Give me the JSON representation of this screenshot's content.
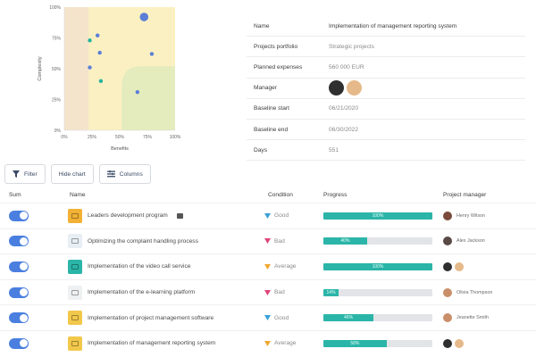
{
  "chart_data": {
    "type": "scatter",
    "xlabel": "Benefits",
    "ylabel": "Complexity",
    "xlim": [
      0,
      100
    ],
    "ylim": [
      0,
      100
    ],
    "x_ticks": [
      "0%",
      "25%",
      "50%",
      "75%",
      "100%"
    ],
    "y_ticks": [
      "0%",
      "25%",
      "50%",
      "75%",
      "100%"
    ],
    "grid": false,
    "points": [
      {
        "x": 72,
        "y": 92,
        "size": "large",
        "color": "#5b7fd6"
      },
      {
        "x": 30,
        "y": 77,
        "size": "small",
        "color": "#5b7fd6"
      },
      {
        "x": 23,
        "y": 73,
        "size": "small",
        "color": "#26b3a0"
      },
      {
        "x": 32,
        "y": 63,
        "size": "small",
        "color": "#5b7fd6"
      },
      {
        "x": 79,
        "y": 62,
        "size": "small",
        "color": "#5b7fd6"
      },
      {
        "x": 23,
        "y": 51,
        "size": "small",
        "color": "#5b7fd6"
      },
      {
        "x": 33,
        "y": 40,
        "size": "small",
        "color": "#26b3a0"
      },
      {
        "x": 66,
        "y": 31,
        "size": "small",
        "color": "#5b7fd6"
      }
    ],
    "colors": {
      "zone_left": "#f5e4cc",
      "zone_main": "#fbf0c2",
      "zone_corner": "#e4ebbd"
    }
  },
  "details": {
    "rows": [
      {
        "label": "Name",
        "value": "Implementation of management reporting system"
      },
      {
        "label": "Projects portfolio",
        "value": "Strategic projects"
      },
      {
        "label": "Planned expenses",
        "value": "560 000 EUR"
      },
      {
        "label": "Manager",
        "value": ""
      },
      {
        "label": "Baseline start",
        "value": "06/21/2020"
      },
      {
        "label": "Baseline end",
        "value": "06/30/2022"
      },
      {
        "label": "Days",
        "value": "551"
      }
    ]
  },
  "toolbar": {
    "filter_label": "Filter",
    "hide_chart_label": "Hide chart",
    "columns_label": "Columns"
  },
  "table": {
    "headers": {
      "sum": "Sum",
      "name": "Name",
      "condition": "Condition",
      "progress": "Progress",
      "manager": "Project manager"
    },
    "rows": [
      {
        "name": "Leaders development program",
        "note": true,
        "condition": "Good",
        "progress": 100,
        "progress_label": "100%",
        "manager": "Henry Wilson",
        "icon_color": "#f2b134",
        "avatars": [
          "#7a4a3a"
        ]
      },
      {
        "name": "Optimizing the complaint handling process",
        "note": false,
        "condition": "Bad",
        "progress": 40,
        "progress_label": "40%",
        "manager": "Alex Jackson",
        "icon_color": "#e7eef4",
        "avatars": [
          "#5a4a45"
        ]
      },
      {
        "name": "Implementation of the video call service",
        "note": false,
        "condition": "Average",
        "progress": 100,
        "progress_label": "100%",
        "manager": "",
        "icon_color": "#2bb5a8",
        "avatars": [
          "#2f2f2f",
          "#e6b98a"
        ]
      },
      {
        "name": "Implementation of the e-learning platform",
        "note": false,
        "condition": "Bad",
        "progress": 14,
        "progress_label": "14%",
        "manager": "Olivia Thompson",
        "icon_color": "#eef0f2",
        "avatars": [
          "#c98f6a"
        ]
      },
      {
        "name": "Implementation of project management software",
        "note": false,
        "condition": "Good",
        "progress": 46,
        "progress_label": "46%",
        "manager": "Jeanette Smith",
        "icon_color": "#f2c84b",
        "avatars": [
          "#c98f6a"
        ]
      },
      {
        "name": "Implementation of management reporting system",
        "note": false,
        "condition": "Average",
        "progress": 58,
        "progress_label": "58%",
        "manager": "",
        "icon_color": "#f2c84b",
        "avatars": [
          "#2f2f2f",
          "#e6b98a"
        ]
      }
    ]
  },
  "condition_colors": {
    "Good": "#3aa0d8",
    "Bad": "#e0447a",
    "Average": "#f0a830"
  },
  "accent": "#4a7fe0",
  "progress_color": "#2bb5a8"
}
